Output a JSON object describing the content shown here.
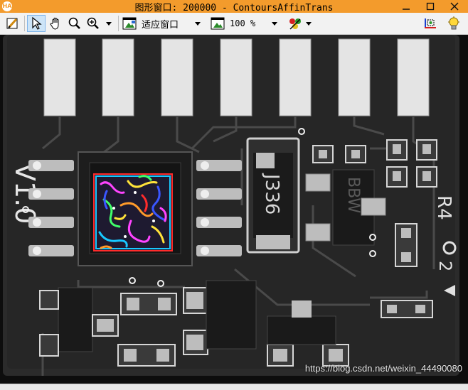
{
  "window": {
    "title": "图形窗口: 200000 - ContoursAffinTrans",
    "logo_text": "HA",
    "buttons": [
      "minimize",
      "maximize",
      "close"
    ]
  },
  "toolbar": {
    "items": [
      {
        "icon": "edit-icon"
      },
      {
        "icon": "pointer-icon",
        "pressed": true
      },
      {
        "icon": "pan-hand-icon"
      },
      {
        "icon": "magnifier-icon"
      },
      {
        "icon": "zoom-in-icon"
      },
      {
        "icon": "window-fit-icon"
      },
      {
        "icon": "zoom-100-icon"
      },
      {
        "icon": "color-palette-icon"
      },
      {
        "icon": "region-xy-icon"
      },
      {
        "icon": "lightbulb-icon"
      }
    ],
    "fit_mode_label": "适应窗口",
    "zoom_label": "100 %"
  },
  "image": {
    "board_text": {
      "version": "V1.0",
      "chip_text": "J336",
      "chip2_text": "BBW",
      "marking": "R4",
      "marking2": "2"
    },
    "overlay_colors": [
      "#ff2b2b",
      "#18c8ff",
      "#ff44ff",
      "#ffe23a",
      "#3a56ff",
      "#40ff6a",
      "#ff9a2a"
    ]
  },
  "watermark": "https://blog.csdn.net/weixin_44490080"
}
